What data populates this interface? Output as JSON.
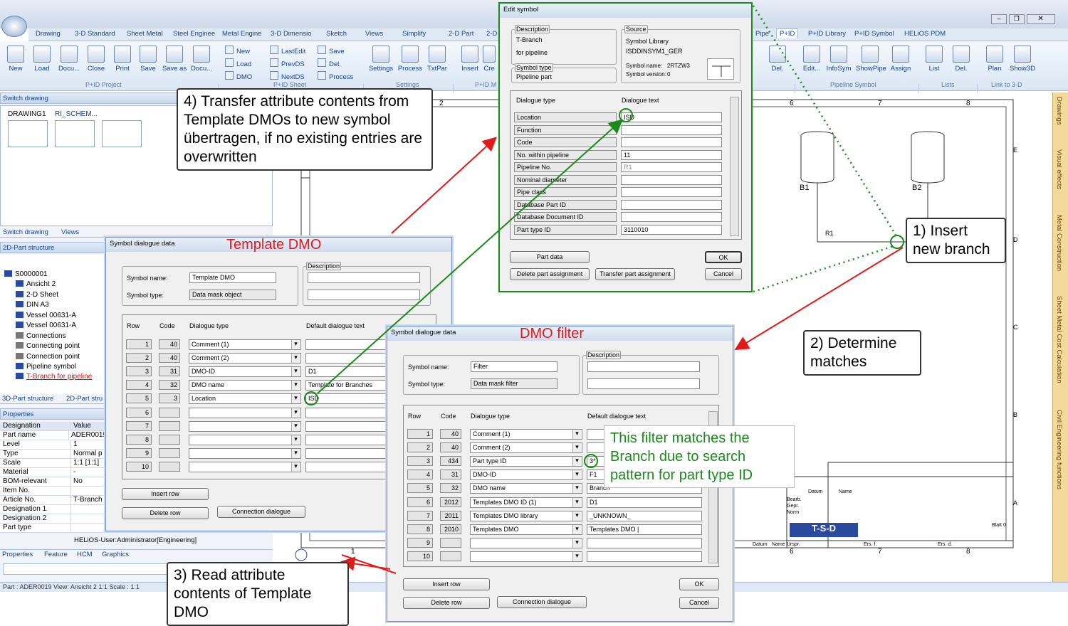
{
  "ribbon": {
    "tabs": [
      "Drawing",
      "3-D Standard",
      "Sheet Metal",
      "Steel Enginee",
      "Metal Engine",
      "3-D Dimensio",
      "Sketch",
      "Views",
      "Simplify",
      "2-D Part",
      "2-D",
      "P+ID",
      "P+ID Library",
      "P+ID Symbol",
      "HELiOS PDM",
      "Pipe"
    ],
    "buttons": [
      "New",
      "Load",
      "Docu...",
      "Close",
      "Print",
      "Save",
      "Save as",
      "Docu...",
      "Settings",
      "Process",
      "TxtPar",
      "Insert",
      "Cre",
      "Del.",
      "Edit...",
      "InfoSym",
      "ShowPipe",
      "Assign",
      "List",
      "Del.",
      "Plan",
      "Show3D"
    ],
    "small": [
      "New",
      "Load",
      "DMO",
      "LastEdit",
      "PrevDS",
      "NextDS",
      "Save",
      "Del.",
      "Process"
    ],
    "groups": [
      "P+ID Project",
      "P+ID Sheet",
      "Settings",
      "P+ID M",
      "Pipeline Symbol",
      "Lists",
      "Link to 3-D"
    ]
  },
  "left": {
    "switch_title": "Switch drawing",
    "drawings": [
      "DRAWING1",
      "RI_SCHEM..."
    ],
    "tabs1": [
      "Switch drawing",
      "Views"
    ],
    "structure_title": "2D-Part structure",
    "tree": [
      "S0000001",
      "Ansicht 2",
      "2-D Sheet",
      "DIN A3",
      "Vessel 00631-A",
      "Vessel 00631-A",
      "Connections",
      "Connecting point",
      "Connection point",
      "Pipeline symbol",
      "T-Branch for pipeline"
    ],
    "tabs2": [
      "3D-Part structure",
      "2D-Part stru"
    ],
    "props_title": "Properties",
    "props_head": [
      "Designation",
      "Value"
    ],
    "props": [
      [
        "Part name",
        "ADER0019"
      ],
      [
        "Level",
        "1"
      ],
      [
        "Type",
        "Normal p"
      ],
      [
        "Scale",
        "1:1 [1:1]"
      ],
      [
        "Material",
        "-"
      ],
      [
        "BOM-relevant",
        "No"
      ],
      [
        "Item No.",
        ""
      ],
      [
        "Article No.",
        "T-Branch"
      ],
      [
        "Designation 1",
        ""
      ],
      [
        "Designation 2",
        ""
      ],
      [
        "Part type",
        ""
      ]
    ],
    "user": "HELiOS-User:Administrator[Engineering]",
    "tabs3": [
      "Properties",
      "Feature",
      "HCM",
      "Graphics"
    ]
  },
  "status": "Part : ADER0019  View: Ansicht 2 1:1  Scale : 1:1",
  "vtabs": [
    "Drawings",
    "Visual effects",
    "Metal Construction",
    "Sheet Metal Cost Calculation",
    "Civil Engineering functions"
  ],
  "drawing": {
    "b1": "B1",
    "b2": "B2",
    "r1": "R1",
    "cols": [
      "2",
      "6",
      "7",
      "8"
    ],
    "rows": [
      "E",
      "D",
      "C",
      "B",
      "A"
    ],
    "bottom": [
      "1",
      "6",
      "7",
      "8"
    ],
    "tb": [
      "Datum",
      "Name",
      "Bearb.",
      "Gepr.",
      "Norm",
      "T-S-D",
      "Blatt 0",
      "Datum",
      "Name",
      "Urspr.",
      "Ers. f.",
      "Ers. d."
    ]
  },
  "edit": {
    "title": "Edit symbol",
    "desc_cap": "Description",
    "desc1": "T-Branch",
    "desc2": "for pipeline",
    "stype_cap": "Symbol type",
    "stype": "Pipeline part",
    "src_cap": "Source",
    "src1": "Symbol Library",
    "src2": "ISDDINSYM1_GER",
    "symname_lbl": "Symbol name:",
    "symname": "2RTZW3",
    "symver_lbl": "Symbol version:",
    "symver": "0",
    "h1": "Dialogue type",
    "h2": "Dialogue text",
    "rows": [
      [
        "Location",
        "ISD"
      ],
      [
        "Function",
        ""
      ],
      [
        "Code",
        ""
      ],
      [
        "No. within pipeline",
        "11"
      ],
      [
        "Pipeline No.",
        "R1"
      ],
      [
        "Nominal diameter",
        ""
      ],
      [
        "Pipe class",
        ""
      ],
      [
        "Database Part ID",
        ""
      ],
      [
        "Database Document ID",
        ""
      ],
      [
        "Part type ID",
        "3110010"
      ]
    ],
    "btn_part": "Part data",
    "btn_ok": "OK",
    "btn_del": "Delete part assignment",
    "btn_transfer": "Transfer part assignment",
    "btn_cancel": "Cancel"
  },
  "tpl": {
    "title": "Symbol dialogue data",
    "symname_lbl": "Symbol name:",
    "symname": "Template DMO",
    "symtype_lbl": "Symbol type:",
    "symtype": "Data mask object",
    "desc_cap": "Description",
    "h": [
      "Row",
      "Code",
      "Dialogue type",
      "Default dialogue text"
    ],
    "rows": [
      [
        "1",
        "40",
        "Comment (1)",
        ""
      ],
      [
        "2",
        "40",
        "Comment (2)",
        ""
      ],
      [
        "3",
        "31",
        "DMO-ID",
        "D1"
      ],
      [
        "4",
        "32",
        "DMO name",
        "Template for Branches"
      ],
      [
        "5",
        "3",
        "Location",
        "ISD"
      ],
      [
        "6",
        "",
        "",
        ""
      ],
      [
        "7",
        "",
        "",
        ""
      ],
      [
        "8",
        "",
        "",
        ""
      ],
      [
        "9",
        "",
        "",
        ""
      ],
      [
        "10",
        "",
        "",
        ""
      ]
    ],
    "btn_insert": "Insert row",
    "btn_delete": "Delete row",
    "btn_conn": "Connection dialogue"
  },
  "flt": {
    "title": "Symbol dialogue data",
    "symname_lbl": "Symbol name:",
    "symname": "Filter",
    "symtype_lbl": "Symbol type:",
    "symtype": "Data mask filter",
    "desc_cap": "Description",
    "h": [
      "Row",
      "Code",
      "Dialogue type",
      "Default dialogue text"
    ],
    "rows": [
      [
        "1",
        "40",
        "Comment (1)",
        ""
      ],
      [
        "2",
        "40",
        "Comment (2)",
        ""
      ],
      [
        "3",
        "434",
        "Part type ID",
        "3*"
      ],
      [
        "4",
        "31",
        "DMO-ID",
        "F1"
      ],
      [
        "5",
        "32",
        "DMO name",
        "Branch"
      ],
      [
        "6",
        "2012",
        "Templates DMO ID (1)",
        "D1"
      ],
      [
        "7",
        "2011",
        "Templates DMO library",
        "_UNKNOWN_"
      ],
      [
        "8",
        "2010",
        "Templates DMO",
        "Templates DMO |"
      ],
      [
        "9",
        "",
        "",
        ""
      ],
      [
        "10",
        "",
        "",
        ""
      ]
    ],
    "btn_insert": "Insert row",
    "btn_ok": "OK",
    "btn_delete": "Delete row",
    "btn_conn": "Connection dialogue",
    "btn_cancel": "Cancel"
  },
  "annot": {
    "c4": "4) Transfer attribute contents from Template DMOs to new symbol übertragen, if no existing entries are overwritten",
    "c1": "1) Insert new branch",
    "c2": "2) Determine matches",
    "c3": "3) Read attribute contents of Template DMO",
    "green": "This filter matches the Branch due to search pattern for part type ID",
    "lbl_tpl": "Template DMO",
    "lbl_flt": "DMO filter"
  }
}
